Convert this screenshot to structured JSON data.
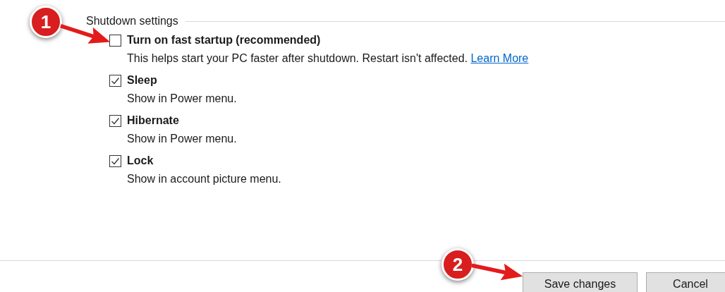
{
  "group": {
    "title": "Shutdown settings"
  },
  "options": [
    {
      "label": "Turn on fast startup (recommended)",
      "checked": false,
      "description": "This helps start your PC faster after shutdown. Restart isn't affected.",
      "link": "Learn More"
    },
    {
      "label": "Sleep",
      "checked": true,
      "description": "Show in Power menu."
    },
    {
      "label": "Hibernate",
      "checked": true,
      "description": "Show in Power menu."
    },
    {
      "label": "Lock",
      "checked": true,
      "description": "Show in account picture menu."
    }
  ],
  "callouts": [
    {
      "number": "1"
    },
    {
      "number": "2"
    }
  ],
  "buttons": [
    {
      "label": "Save changes"
    },
    {
      "label": "Cancel"
    }
  ]
}
